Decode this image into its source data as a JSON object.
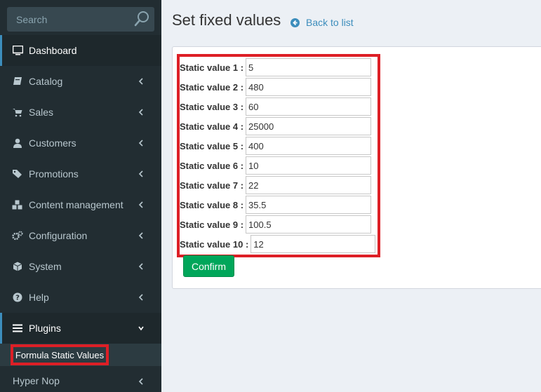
{
  "search": {
    "placeholder": "Search"
  },
  "sidebar": {
    "items": [
      {
        "label": "Dashboard",
        "icon": "monitor-icon"
      },
      {
        "label": "Catalog",
        "icon": "book-icon"
      },
      {
        "label": "Sales",
        "icon": "cart-icon"
      },
      {
        "label": "Customers",
        "icon": "user-icon"
      },
      {
        "label": "Promotions",
        "icon": "tags-icon"
      },
      {
        "label": "Content management",
        "icon": "cubes-icon"
      },
      {
        "label": "Configuration",
        "icon": "gears-icon"
      },
      {
        "label": "System",
        "icon": "cube-icon"
      },
      {
        "label": "Help",
        "icon": "question-icon"
      },
      {
        "label": "Plugins",
        "icon": "bars-icon"
      }
    ],
    "submenu_item": "Formula Static Values",
    "last_item": "Hyper Nop"
  },
  "page": {
    "title": "Set fixed values",
    "back_link": "Back to list"
  },
  "form": {
    "fields": [
      {
        "label": "Static value 1 :",
        "value": "5"
      },
      {
        "label": "Static value 2 :",
        "value": "480"
      },
      {
        "label": "Static value 3 :",
        "value": "60"
      },
      {
        "label": "Static value 4 :",
        "value": "25000"
      },
      {
        "label": "Static value 5 :",
        "value": "400"
      },
      {
        "label": "Static value 6 :",
        "value": "10"
      },
      {
        "label": "Static value 7 :",
        "value": "22"
      },
      {
        "label": "Static value 8 :",
        "value": "35.5"
      },
      {
        "label": "Static value 9 :",
        "value": "100.5"
      },
      {
        "label": "Static value 10 :",
        "value": "12"
      }
    ],
    "confirm_label": "Confirm"
  },
  "colors": {
    "sidebar_bg": "#222d32",
    "accent": "#3c8dbc",
    "highlight": "#dd1f26",
    "confirm": "#00a65a"
  }
}
